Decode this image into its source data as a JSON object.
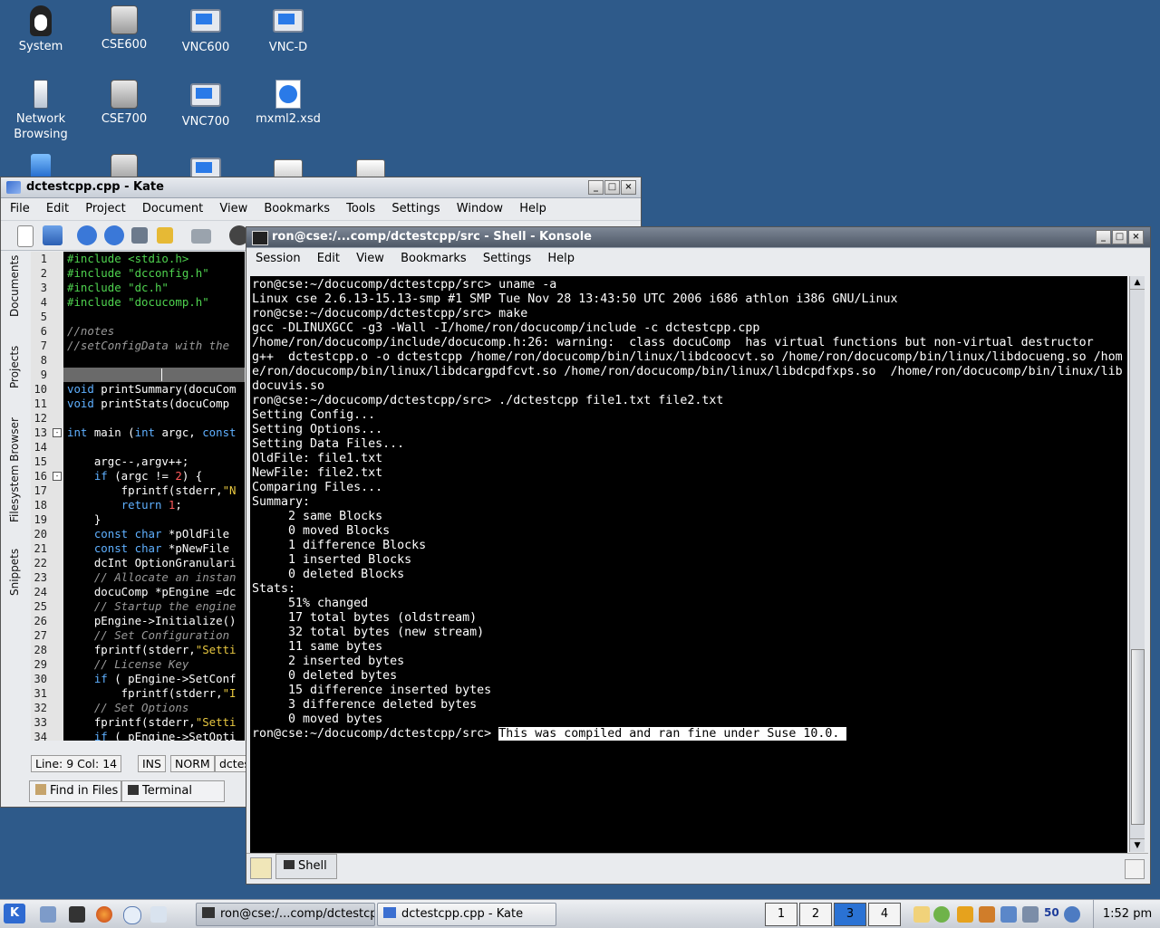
{
  "desktop": {
    "icons": [
      {
        "label": "System",
        "icon": "tux-computer-icon"
      },
      {
        "label": "CSE600",
        "icon": "hard-drive-icon"
      },
      {
        "label": "VNC600",
        "icon": "monitor-icon"
      },
      {
        "label": "VNC-D",
        "icon": "monitor-icon"
      },
      {
        "label": "Network\nBrowsing",
        "icon": "network-icon"
      },
      {
        "label": "CSE700",
        "icon": "hard-drive-icon"
      },
      {
        "label": "VNC700",
        "icon": "monitor-icon"
      },
      {
        "label": "mxml2.xsd",
        "icon": "xsd-file-icon"
      }
    ]
  },
  "kate": {
    "title": "dctestcpp.cpp - Kate",
    "menu": [
      "File",
      "Edit",
      "Project",
      "Document",
      "View",
      "Bookmarks",
      "Tools",
      "Settings",
      "Window",
      "Help"
    ],
    "side_tabs": [
      "Documents",
      "Projects",
      "Filesystem Browser",
      "Snippets"
    ],
    "line_numbers": [
      "1",
      "2",
      "3",
      "4",
      "5",
      "6",
      "7",
      "8",
      "9",
      "10",
      "11",
      "12",
      "13",
      "14",
      "15",
      "16",
      "17",
      "18",
      "19",
      "20",
      "21",
      "22",
      "23",
      "24",
      "25",
      "26",
      "27",
      "28",
      "29",
      "30",
      "31",
      "32",
      "33",
      "34"
    ],
    "code_lines": [
      "#include <stdio.h>",
      "#include \"dcconfig.h\"",
      "#include \"dc.h\"",
      "#include \"docucomp.h\"",
      "",
      "//notes",
      "//setConfigData with the",
      "",
      "",
      "void printSummary(docuCom",
      "void printStats(docuComp",
      "",
      "int main (int argc, const",
      "",
      "    argc--,argv++;",
      "    if (argc != 2) {",
      "        fprintf(stderr,\"N",
      "        return 1;",
      "    }",
      "    const char *pOldFile",
      "    const char *pNewFile",
      "    dcInt OptionGranulari",
      "    // Allocate an instan",
      "    docuComp *pEngine =dc",
      "    // Startup the engine",
      "    pEngine->Initialize()",
      "    // Set Configuration",
      "    fprintf(stderr,\"Setti",
      "    // License Key",
      "    if ( pEngine->SetConf",
      "        fprintf(stderr,\"I",
      "    // Set Options",
      "    fprintf(stderr,\"Setti",
      "    if ( pEngine->SetOpti"
    ],
    "status": {
      "position": "Line: 9 Col: 14",
      "ins": "INS",
      "norm": "NORM",
      "file": "dctes"
    },
    "bottom_tabs": [
      "Find in Files",
      "Terminal"
    ]
  },
  "konsole": {
    "title": "ron@cse:/...comp/dctestcpp/src - Shell - Konsole",
    "menu": [
      "Session",
      "Edit",
      "View",
      "Bookmarks",
      "Settings",
      "Help"
    ],
    "lines": [
      "ron@cse:~/docucomp/dctestcpp/src> uname -a",
      "Linux cse 2.6.13-15.13-smp #1 SMP Tue Nov 28 13:43:50 UTC 2006 i686 athlon i386 GNU/Linux",
      "ron@cse:~/docucomp/dctestcpp/src> make",
      "gcc -DLINUXGCC -g3 -Wall -I/home/ron/docucomp/include -c dctestcpp.cpp",
      "/home/ron/docucomp/include/docucomp.h:26: warning:  class docuComp  has virtual functions but non-virtual destructor",
      "g++  dctestcpp.o -o dctestcpp /home/ron/docucomp/bin/linux/libdcoocvt.so /home/ron/docucomp/bin/linux/libdocueng.so /hom",
      "e/ron/docucomp/bin/linux/libdcargpdfcvt.so /home/ron/docucomp/bin/linux/libdcpdfxps.so  /home/ron/docucomp/bin/linux/lib",
      "docuvis.so",
      "ron@cse:~/docucomp/dctestcpp/src> ./dctestcpp file1.txt file2.txt",
      "Setting Config...",
      "Setting Options...",
      "Setting Data Files...",
      "OldFile: file1.txt",
      "NewFile: file2.txt",
      "Comparing Files...",
      "Summary:",
      "     2 same Blocks",
      "     0 moved Blocks",
      "     1 difference Blocks",
      "     1 inserted Blocks",
      "     0 deleted Blocks",
      "Stats:",
      "     51% changed",
      "     17 total bytes (oldstream)",
      "     32 total bytes (new stream)",
      "     11 same bytes",
      "     2 inserted bytes",
      "     0 deleted bytes",
      "     15 difference inserted bytes",
      "     3 difference deleted bytes",
      "     0 moved bytes"
    ],
    "prompt": "ron@cse:~/docucomp/dctestcpp/src> ",
    "highlighted": "This was compiled and ran fine under Suse 10.0. ",
    "tab_label": "Shell"
  },
  "taskbar": {
    "tasks": [
      "ron@cse:/...comp/dctestcpp",
      "dctestcpp.cpp - Kate"
    ],
    "desktops": [
      "1",
      "2",
      "3",
      "4"
    ],
    "active_desktop": "3",
    "tray_number": "50",
    "clock": "1:52 pm"
  },
  "colors": {
    "desktop_bg": "#2e5a8a",
    "terminal_bg": "#000000",
    "code_keyword": "#5fb0ff",
    "code_comment": "#9a9a9a",
    "code_string": "#e8c840",
    "code_number": "#ff5a5a",
    "code_include": "#4fd34f"
  }
}
